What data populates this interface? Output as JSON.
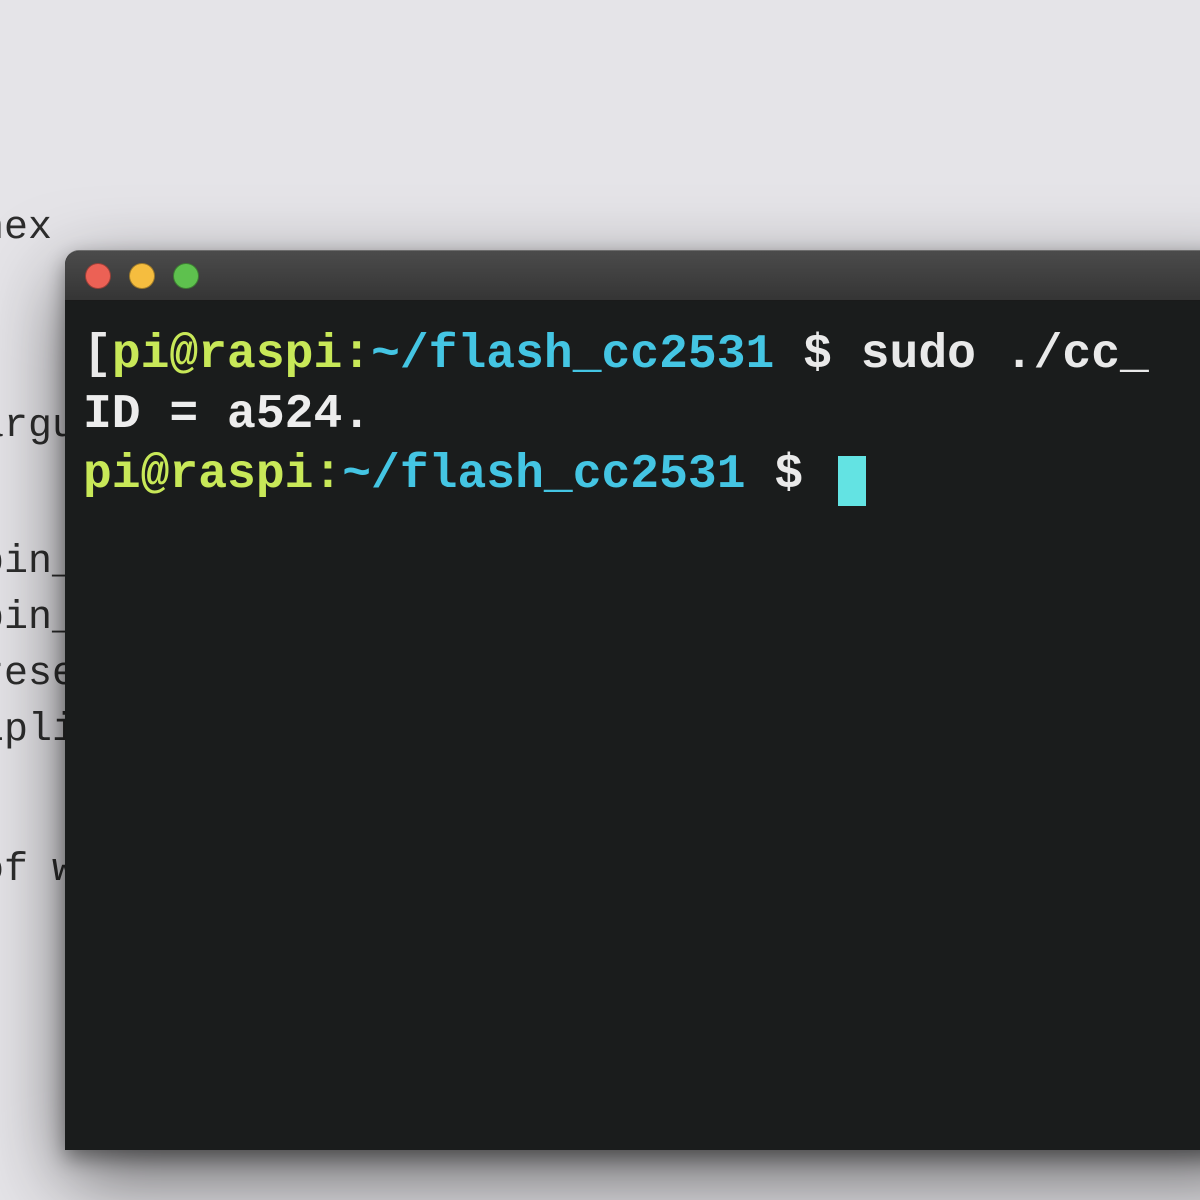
{
  "background": {
    "l1": "hex",
    "l2": "argu",
    "l3": "bin_",
    "l4": "bin_",
    "l5": "rese",
    "l6": "ipli",
    "l7": "of wi"
  },
  "window": {
    "traffic": {
      "close": "red",
      "minimize": "yellow",
      "zoom": "green"
    }
  },
  "terminal": {
    "line1": {
      "bracket": "[",
      "user_host": "pi@raspi",
      "colon": ":",
      "path": "~/flash_cc2531",
      "sep": " $ ",
      "command": "sudo ./cc_"
    },
    "line2": "  ID = a524.",
    "line3": {
      "user_host": "pi@raspi",
      "colon": ":",
      "path": "~/flash_cc2531",
      "sep": " $ "
    }
  }
}
